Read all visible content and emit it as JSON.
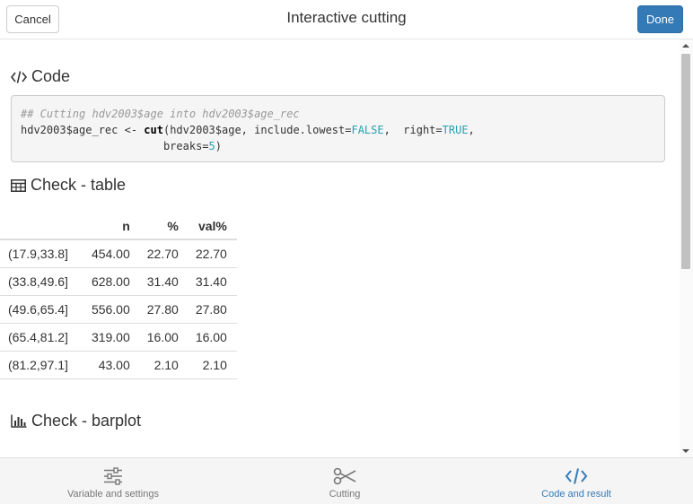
{
  "header": {
    "cancel_label": "Cancel",
    "title": "Interactive cutting",
    "done_label": "Done"
  },
  "code_section": {
    "title": "Code",
    "icon": "code-icon",
    "comment": "## Cutting hdv2003$age into hdv2003$age_rec",
    "line2_a": "hdv2003$age_rec <- ",
    "line2_func": "cut",
    "line2_b": "(hdv2003$age, include.lowest=",
    "line2_false": "FALSE",
    "line2_c": ",  right=",
    "line2_true": "TRUE",
    "line2_d": ",",
    "line3_a": "                      breaks=",
    "line3_num": "5",
    "line3_b": ")"
  },
  "table_section": {
    "title": "Check - table",
    "icon": "table-icon",
    "headers": [
      "",
      "n",
      "%",
      "val%"
    ],
    "rows": [
      [
        "(17.9,33.8]",
        "454.00",
        "22.70",
        "22.70"
      ],
      [
        "(33.8,49.6]",
        "628.00",
        "31.40",
        "31.40"
      ],
      [
        "(49.6,65.4]",
        "556.00",
        "27.80",
        "27.80"
      ],
      [
        "(65.4,81.2]",
        "319.00",
        "16.00",
        "16.00"
      ],
      [
        "(81.2,97.1]",
        "43.00",
        "2.10",
        "2.10"
      ]
    ]
  },
  "barplot_section": {
    "title": "Check - barplot",
    "icon": "bar-chart-icon"
  },
  "tabs": [
    {
      "label": "Variable and settings",
      "icon": "sliders-icon",
      "active": false
    },
    {
      "label": "Cutting",
      "icon": "scissors-icon",
      "active": false
    },
    {
      "label": "Code and result",
      "icon": "code-icon",
      "active": true
    }
  ],
  "colors": {
    "accent": "#337ab7",
    "code_constant": "#27a2b0"
  }
}
